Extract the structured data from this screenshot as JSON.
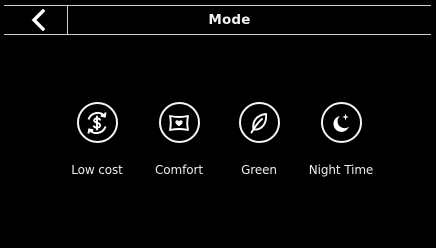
{
  "header": {
    "title": "Mode",
    "back_icon": "chevron-left-icon"
  },
  "modes": [
    {
      "label": "Low cost",
      "icon": "dollar-cycle-icon"
    },
    {
      "label": "Comfort",
      "icon": "pillow-heart-icon"
    },
    {
      "label": "Green",
      "icon": "leaf-icon"
    },
    {
      "label": "Night Time",
      "icon": "moon-star-icon"
    }
  ],
  "colors": {
    "background": "#000000",
    "foreground": "#ffffff",
    "divider": "#cfcfcf"
  }
}
